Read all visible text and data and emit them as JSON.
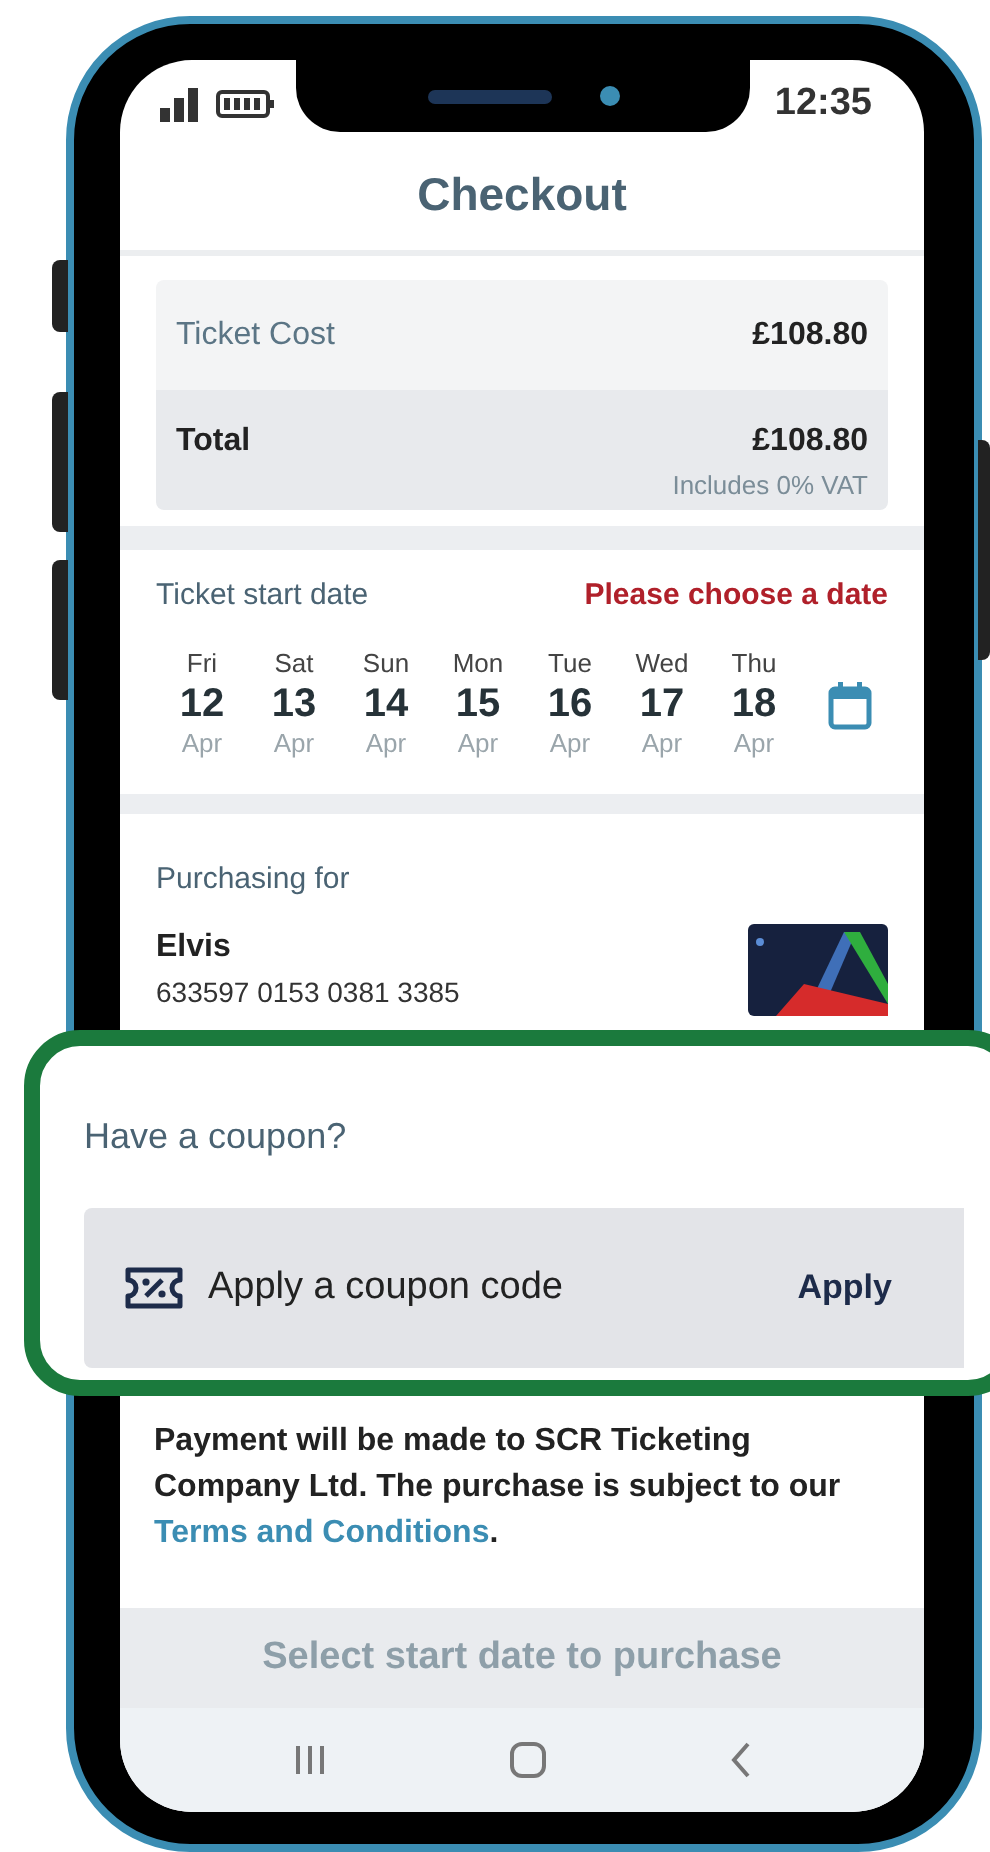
{
  "status_bar": {
    "time": "12:35"
  },
  "header": {
    "title": "Checkout"
  },
  "summary": [
    {
      "kind": "cost",
      "label": "Ticket Cost",
      "amount": "£108.80"
    },
    {
      "kind": "total",
      "label": "Total",
      "amount": "£108.80",
      "note": "Includes 0% VAT"
    }
  ],
  "start_date": {
    "label": "Ticket start date",
    "error": "Please choose a date",
    "dates": [
      {
        "day": "Fri",
        "date": "12",
        "month": "Apr",
        "selected": false
      },
      {
        "day": "Sat",
        "date": "13",
        "month": "Apr",
        "selected": false
      },
      {
        "day": "Sun",
        "date": "14",
        "month": "Apr",
        "selected": false
      },
      {
        "day": "Mon",
        "date": "15",
        "month": "Apr",
        "selected": false
      },
      {
        "day": "Tue",
        "date": "16",
        "month": "Apr",
        "selected": false
      },
      {
        "day": "Wed",
        "date": "17",
        "month": "Apr",
        "selected": false
      },
      {
        "day": "Thu",
        "date": "18",
        "month": "Apr",
        "selected": false
      }
    ]
  },
  "purchasing_for": {
    "label": "Purchasing for",
    "name": "Elvis",
    "card_number": "633597 0153 0381 3385"
  },
  "coupon": {
    "heading": "Have a coupon?",
    "placeholder": "Apply a coupon code",
    "button": "Apply"
  },
  "payment_note": {
    "text": "Payment will be made to SCR Ticketing Company Ltd. The purchase is subject to our ",
    "link": "Terms and Conditions",
    "end": "."
  },
  "purchase_button": {
    "label": "Select start date to purchase",
    "disabled": true
  }
}
